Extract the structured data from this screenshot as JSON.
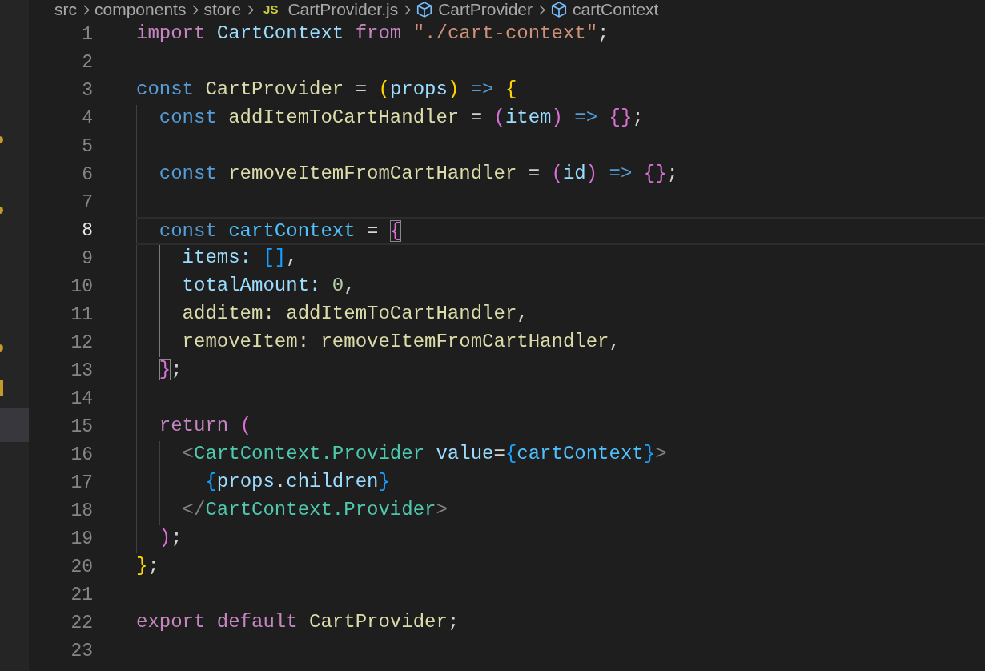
{
  "breadcrumbs": [
    {
      "kind": "folder",
      "label": "src"
    },
    {
      "kind": "folder",
      "label": "components"
    },
    {
      "kind": "folder",
      "label": "store"
    },
    {
      "kind": "file",
      "badge": "JS",
      "label": "CartProvider.js"
    },
    {
      "kind": "symbol",
      "label": "CartProvider"
    },
    {
      "kind": "symbol",
      "label": "cartContext"
    }
  ],
  "gutter_markers": [
    {
      "kind": "dot"
    },
    {
      "kind": "dot"
    },
    {
      "kind": "dot"
    },
    {
      "kind": "bar"
    },
    {
      "kind": "selected-row"
    }
  ],
  "lines": [
    {
      "number": "1",
      "selected": false,
      "tokens": [
        {
          "text": "import ",
          "kind": "keyword"
        },
        {
          "text": "CartContext ",
          "kind": "variable"
        },
        {
          "text": "from ",
          "kind": "keyword"
        },
        {
          "text": "\"./cart-context\"",
          "kind": "string"
        },
        {
          "text": ";",
          "kind": "plain"
        }
      ]
    },
    {
      "number": "2",
      "selected": false
    },
    {
      "number": "3",
      "selected": false,
      "tokens": [
        {
          "text": "const ",
          "kind": "storage"
        },
        {
          "text": "CartProvider ",
          "kind": "function"
        },
        {
          "text": "= ",
          "kind": "plain"
        },
        {
          "text": "(",
          "kind": "bracket1"
        },
        {
          "text": "props",
          "kind": "variable"
        },
        {
          "text": ")",
          "kind": "bracket1"
        },
        {
          "text": " => ",
          "kind": "storage"
        },
        {
          "text": "{",
          "kind": "bracket1"
        }
      ]
    },
    {
      "number": "4",
      "selected": false,
      "tokens": [
        {
          "text": "  const ",
          "kind": "storage"
        },
        {
          "text": "addItemToCartHandler ",
          "kind": "function"
        },
        {
          "text": "= ",
          "kind": "plain"
        },
        {
          "text": "(",
          "kind": "bracket2"
        },
        {
          "text": "item",
          "kind": "variable"
        },
        {
          "text": ")",
          "kind": "bracket2"
        },
        {
          "text": " => ",
          "kind": "storage"
        },
        {
          "text": "{}",
          "kind": "bracket2"
        },
        {
          "text": ";",
          "kind": "plain"
        }
      ]
    },
    {
      "number": "5",
      "selected": false
    },
    {
      "number": "6",
      "selected": false,
      "tokens": [
        {
          "text": "  const ",
          "kind": "storage"
        },
        {
          "text": "removeItemFromCartHandler ",
          "kind": "function"
        },
        {
          "text": "= ",
          "kind": "plain"
        },
        {
          "text": "(",
          "kind": "bracket2"
        },
        {
          "text": "id",
          "kind": "variable"
        },
        {
          "text": ")",
          "kind": "bracket2"
        },
        {
          "text": " => ",
          "kind": "storage"
        },
        {
          "text": "{}",
          "kind": "bracket2"
        },
        {
          "text": ";",
          "kind": "plain"
        }
      ]
    },
    {
      "number": "7",
      "selected": false
    },
    {
      "number": "8",
      "selected": true,
      "tokens": [
        {
          "text": "  const ",
          "kind": "storage"
        },
        {
          "text": "cartContext ",
          "kind": "constant"
        },
        {
          "text": "= ",
          "kind": "plain"
        },
        {
          "text": "{",
          "kind": "bracket2_match"
        }
      ]
    },
    {
      "number": "9",
      "selected": false,
      "tokens": [
        {
          "text": "    items: ",
          "kind": "property"
        },
        {
          "text": "[]",
          "kind": "bracket3"
        },
        {
          "text": ",",
          "kind": "plain"
        }
      ]
    },
    {
      "number": "10",
      "selected": false,
      "tokens": [
        {
          "text": "    totalAmount: ",
          "kind": "property"
        },
        {
          "text": "0",
          "kind": "number"
        },
        {
          "text": ",",
          "kind": "plain"
        }
      ]
    },
    {
      "number": "11",
      "selected": false,
      "tokens": [
        {
          "text": "    additem: ",
          "kind": "function"
        },
        {
          "text": "addItemToCartHandler",
          "kind": "function"
        },
        {
          "text": ",",
          "kind": "plain"
        }
      ]
    },
    {
      "number": "12",
      "selected": false,
      "tokens": [
        {
          "text": "    removeItem: ",
          "kind": "function"
        },
        {
          "text": "removeItemFromCartHandler",
          "kind": "function"
        },
        {
          "text": ",",
          "kind": "plain"
        }
      ]
    },
    {
      "number": "13",
      "selected": false,
      "tokens": [
        {
          "text": "  }",
          "kind": "bracket2_match"
        },
        {
          "text": ";",
          "kind": "plain"
        }
      ]
    },
    {
      "number": "14",
      "selected": false
    },
    {
      "number": "15",
      "selected": false,
      "tokens": [
        {
          "text": "  return ",
          "kind": "keyword"
        },
        {
          "text": "(",
          "kind": "bracket2"
        }
      ]
    },
    {
      "number": "16",
      "selected": false,
      "tokens": [
        {
          "text": "    <",
          "kind": "tagpunct"
        },
        {
          "text": "CartContext.Provider",
          "kind": "tag"
        },
        {
          "text": " value",
          "kind": "property"
        },
        {
          "text": "=",
          "kind": "plain"
        },
        {
          "text": "{",
          "kind": "bracket3"
        },
        {
          "text": "cartContext",
          "kind": "constant"
        },
        {
          "text": "}",
          "kind": "bracket3"
        },
        {
          "text": ">",
          "kind": "tagpunct"
        }
      ]
    },
    {
      "number": "17",
      "selected": false,
      "tokens": [
        {
          "text": "      {",
          "kind": "bracket3"
        },
        {
          "text": "props",
          "kind": "property"
        },
        {
          "text": ".",
          "kind": "plain"
        },
        {
          "text": "children",
          "kind": "property"
        },
        {
          "text": "}",
          "kind": "bracket3"
        }
      ]
    },
    {
      "number": "18",
      "selected": false,
      "tokens": [
        {
          "text": "    </",
          "kind": "tagpunct"
        },
        {
          "text": "CartContext.Provider",
          "kind": "tag"
        },
        {
          "text": ">",
          "kind": "tagpunct"
        }
      ]
    },
    {
      "number": "19",
      "selected": false,
      "tokens": [
        {
          "text": "  )",
          "kind": "bracket2"
        },
        {
          "text": ";",
          "kind": "plain"
        }
      ]
    },
    {
      "number": "20",
      "selected": false,
      "tokens": [
        {
          "text": "}",
          "kind": "bracket1"
        },
        {
          "text": ";",
          "kind": "plain"
        }
      ]
    },
    {
      "number": "21",
      "selected": false
    },
    {
      "number": "22",
      "selected": false,
      "tokens": [
        {
          "text": "export default ",
          "kind": "keyword"
        },
        {
          "text": "CartProvider",
          "kind": "function"
        },
        {
          "text": ";",
          "kind": "plain"
        }
      ]
    },
    {
      "number": "23",
      "selected": false
    }
  ]
}
